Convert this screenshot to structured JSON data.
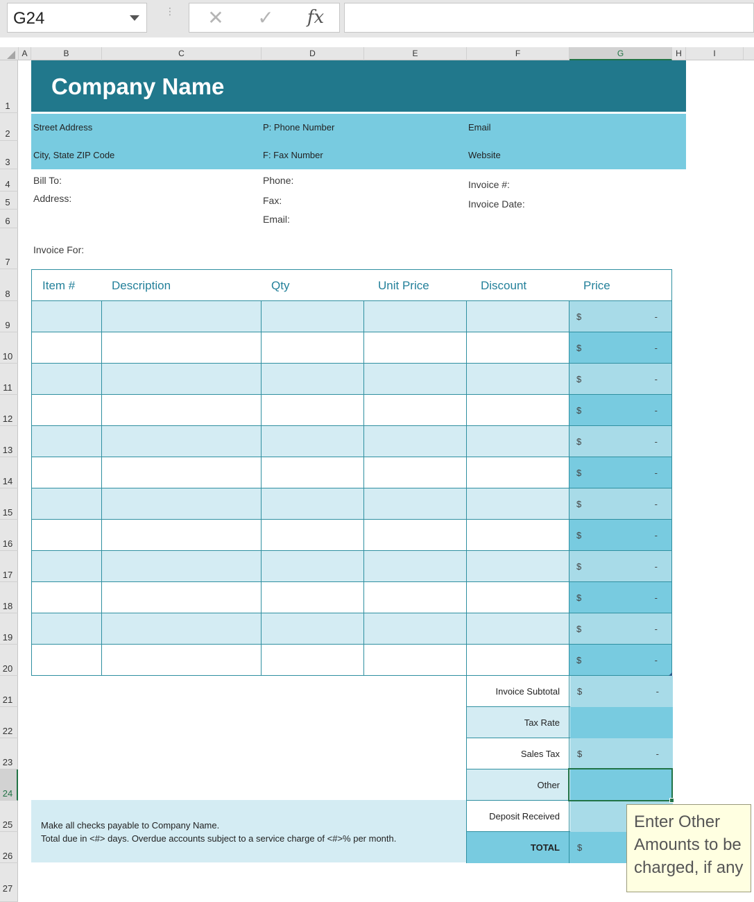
{
  "formula_bar": {
    "name_box": "G24",
    "cancel_icon": "✕",
    "enter_icon": "✓",
    "fx_label": "fx",
    "formula": ""
  },
  "columns": [
    "A",
    "B",
    "C",
    "D",
    "E",
    "F",
    "G",
    "H",
    "I"
  ],
  "rows": [
    "1",
    "2",
    "3",
    "4",
    "5",
    "6",
    "7",
    "8",
    "9",
    "10",
    "11",
    "12",
    "13",
    "14",
    "15",
    "16",
    "17",
    "18",
    "19",
    "20",
    "21",
    "22",
    "23",
    "24",
    "25",
    "26",
    "27"
  ],
  "header": {
    "company_name": "Company Name",
    "street": "Street Address",
    "city": "City, State ZIP Code",
    "phone": "P: Phone Number",
    "fax": "F: Fax Number",
    "email": "Email",
    "website": "Website"
  },
  "bill": {
    "bill_to": "Bill To:",
    "address": "Address:",
    "phone": "Phone:",
    "fax": "Fax:",
    "email": "Email:",
    "invoice_no": "Invoice #:",
    "invoice_date": "Invoice Date:",
    "invoice_for": "Invoice For:"
  },
  "table": {
    "headers": [
      "Item #",
      "Description",
      "Qty",
      "Unit Price",
      "Discount",
      "Price"
    ],
    "currency": "$",
    "empty_value": "-"
  },
  "totals": {
    "subtotal": "Invoice Subtotal",
    "tax_rate": "Tax Rate",
    "sales_tax": "Sales Tax",
    "other": "Other",
    "deposit": "Deposit Received",
    "total": "TOTAL"
  },
  "notes": {
    "line1": "Make all checks payable to Company Name.",
    "line2": "Total due in <#> days. Overdue accounts subject to a service charge of <#>% per month."
  },
  "tooltip": "Enter Other Amounts to be charged, if any",
  "colors": {
    "title_band": "#21788c",
    "contact_band": "#78cbe0",
    "alt_row": "#d4ecf3",
    "price_dark": "#78cbe0",
    "price_light": "#a8dbe8",
    "selection": "#217346"
  }
}
